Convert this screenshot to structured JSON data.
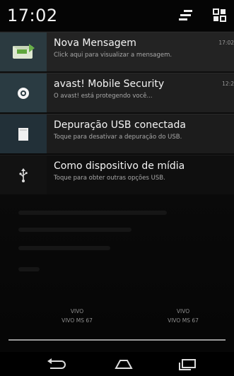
{
  "status": {
    "time": "17:02",
    "icons": {
      "settings": "settings-sliders-icon",
      "quick_settings": "quick-settings-grid-icon"
    }
  },
  "notifications": [
    {
      "title": "Nova Mensagem",
      "text": "Click aqui para visualizar a mensagem.",
      "time": "17:02",
      "icon": "sms-icon"
    },
    {
      "title": "avast! Mobile Security",
      "text": "O avast! está protegendo você...",
      "time": "12:2",
      "icon": "avast-icon"
    },
    {
      "title": "Depuração USB conectada",
      "text": "Toque para desativar a depuração do USB.",
      "time": "",
      "icon": "usb-debug-icon"
    },
    {
      "title": "Como dispositivo de mídia",
      "text": "Toque para obter outras opções USB.",
      "time": "",
      "icon": "usb-icon"
    }
  ],
  "carriers": [
    {
      "name": "VIVO",
      "detail": "VIVO MS 67"
    },
    {
      "name": "VIVO",
      "detail": "VIVO MS 67"
    }
  ],
  "navbar": {
    "back": "back-icon",
    "home": "home-icon",
    "recent": "recent-apps-icon"
  },
  "colors": {
    "background": "#0b0b0b",
    "notification": "#1e1e1e",
    "icon_tile": "#2b3a40"
  }
}
